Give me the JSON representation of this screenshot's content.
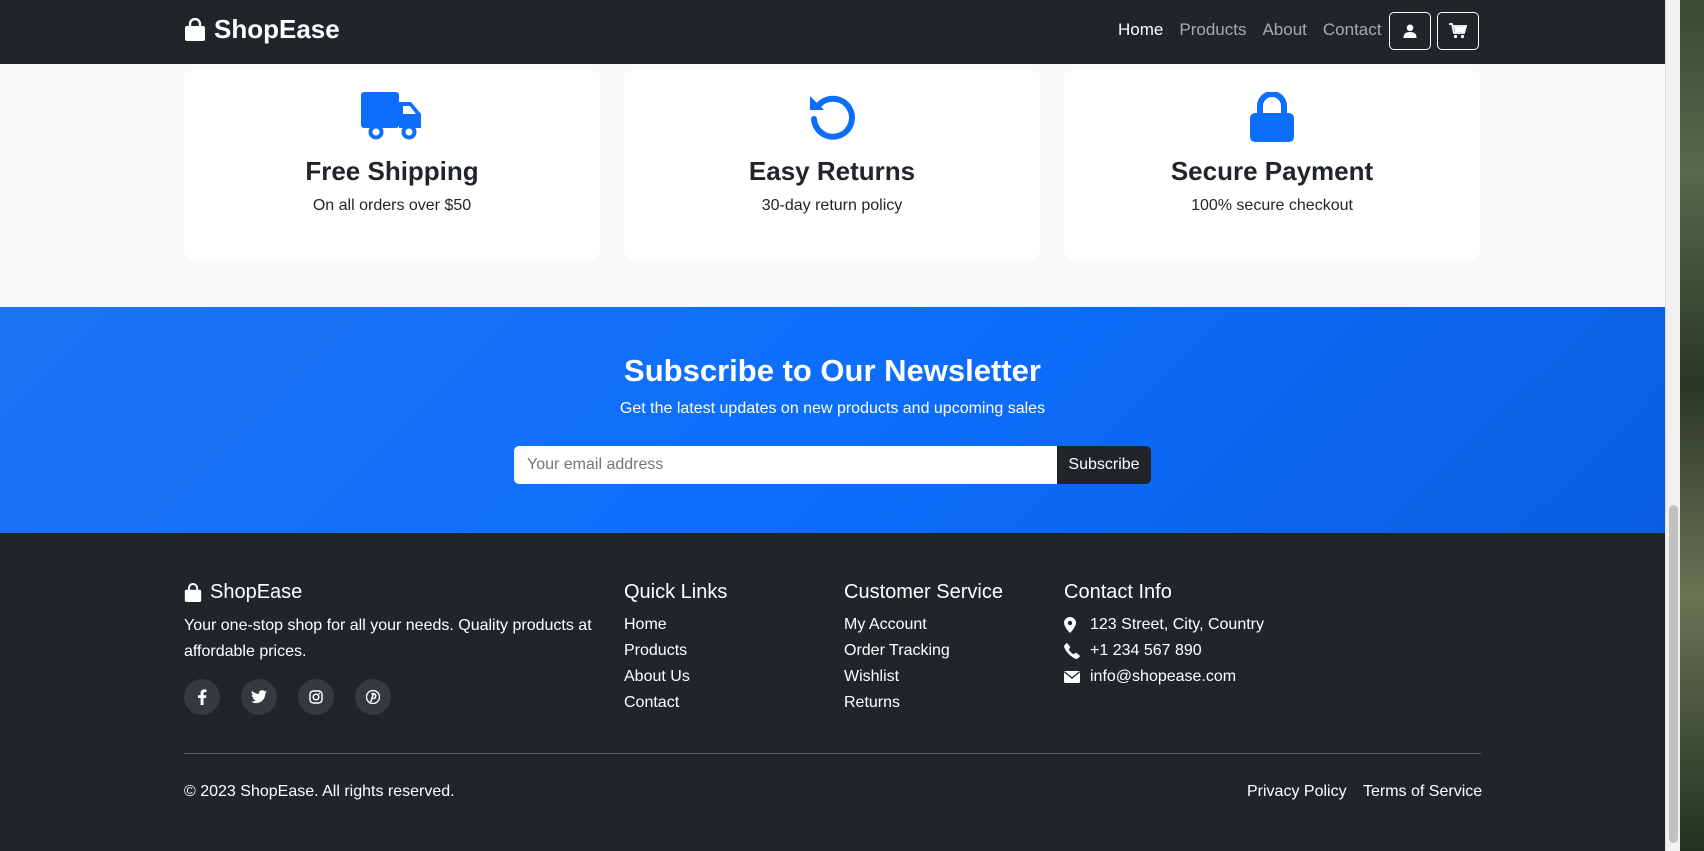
{
  "navbar": {
    "brand": "ShopEase",
    "links": [
      {
        "label": "Home",
        "active": true
      },
      {
        "label": "Products",
        "active": false
      },
      {
        "label": "About",
        "active": false
      },
      {
        "label": "Contact",
        "active": false
      }
    ],
    "buttons": [
      {
        "icon": "user-icon"
      },
      {
        "icon": "cart-icon"
      }
    ]
  },
  "features": [
    {
      "icon": "truck-icon",
      "title": "Free Shipping",
      "text": "On all orders over $50"
    },
    {
      "icon": "undo-icon",
      "title": "Easy Returns",
      "text": "30-day return policy"
    },
    {
      "icon": "lock-icon",
      "title": "Secure Payment",
      "text": "100% secure checkout"
    }
  ],
  "newsletter": {
    "title": "Subscribe to Our Newsletter",
    "subtitle": "Get the latest updates on new products and upcoming sales",
    "placeholder": "Your email address",
    "button": "Subscribe"
  },
  "footer": {
    "brand": "ShopEase",
    "description": "Your one-stop shop for all your needs. Quality products at affordable prices.",
    "social": [
      "facebook-icon",
      "twitter-icon",
      "instagram-icon",
      "pinterest-icon"
    ],
    "quick_links": {
      "title": "Quick Links",
      "items": [
        "Home",
        "Products",
        "About Us",
        "Contact"
      ]
    },
    "customer_service": {
      "title": "Customer Service",
      "items": [
        "My Account",
        "Order Tracking",
        "Wishlist",
        "Returns"
      ]
    },
    "contact": {
      "title": "Contact Info",
      "address": "123 Street, City, Country",
      "phone": "+1 234 567 890",
      "email": "info@shopease.com"
    },
    "copyright": "© 2023 ShopEase. All rights reserved.",
    "privacy": "Privacy Policy",
    "terms": "Terms of Service"
  },
  "colors": {
    "accent": "#0d6efd",
    "dark": "#212529",
    "light_bg": "#f8f9fa"
  }
}
